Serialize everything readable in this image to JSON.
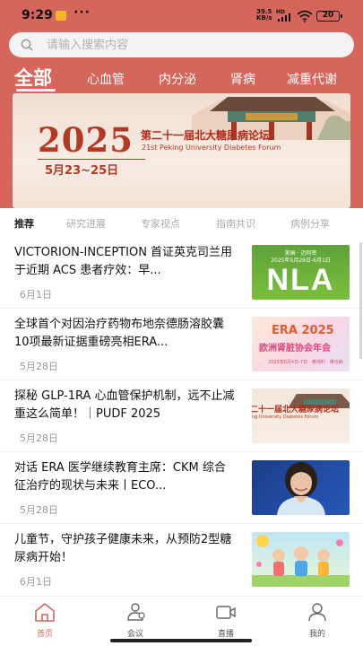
{
  "status_bar": {
    "time": "9:29",
    "dots": "···",
    "net_speed_value": "39.5",
    "net_speed_unit": "KB/s",
    "hd": "HD",
    "battery": "20"
  },
  "search": {
    "placeholder": "请输入搜索内容",
    "value": ""
  },
  "categories": [
    {
      "label": "全部",
      "active": true
    },
    {
      "label": "心血管",
      "active": false
    },
    {
      "label": "内分泌",
      "active": false
    },
    {
      "label": "肾病",
      "active": false
    },
    {
      "label": "减重代谢",
      "active": false
    }
  ],
  "banner": {
    "year": "2025",
    "title": "第二十一届北大糖尿病论坛",
    "subtitle": "21st Peking University Diabetes Forum",
    "date": "5月23~25日"
  },
  "sub_tabs": [
    {
      "label": "推荐",
      "active": true
    },
    {
      "label": "研究进展",
      "active": false
    },
    {
      "label": "专家视点",
      "active": false
    },
    {
      "label": "指南共识",
      "active": false
    },
    {
      "label": "病例分享",
      "active": false
    }
  ],
  "articles": [
    {
      "title": "VICTORION-INCEPTION 首证英克司兰用于近期 ACS 患者疗效：早...",
      "date": "6月1日",
      "thumb": {
        "kind": "nla",
        "top_text": "美国 · 迈阿密",
        "top_text_2": "2025年5月29日-6月1日",
        "logo": "NLA"
      }
    },
    {
      "title": "全球首个对因治疗药物布地奈德肠溶胶囊10项最新证据重磅亮相ERA...",
      "date": "5月28日",
      "thumb": {
        "kind": "era",
        "line1": "ERA 2025",
        "line2": "欧洲肾脏协会年会",
        "line3": "2025年6月4日-7日 · 奥地利 · 维也纳"
      }
    },
    {
      "title": "探秘 GLP-1RA 心血管保护机制，远不止减重这么简单！｜PUDF 2025",
      "date": "5月28日",
      "thumb": {
        "kind": "forum",
        "line1": "二十一届北大糖尿病论坛",
        "line2": "ng University Diabetes Forum"
      }
    },
    {
      "title": "对话 ERA 医学继续教育主席：CKM 综合征治疗的现状与未来丨ECO...",
      "date": "5月28日",
      "thumb": {
        "kind": "portrait"
      }
    },
    {
      "title": "儿童节，守护孩子健康未来，从预防2型糖尿病开始！",
      "date": "6月1日",
      "thumb": {
        "kind": "kids"
      }
    }
  ],
  "bottom_nav": [
    {
      "label": "首页",
      "icon": "home-icon",
      "active": true
    },
    {
      "label": "会议",
      "icon": "meeting-icon",
      "active": false
    },
    {
      "label": "直播",
      "icon": "live-icon",
      "active": false
    },
    {
      "label": "我的",
      "icon": "profile-icon",
      "active": false
    }
  ],
  "colors": {
    "accent": "#d6665c",
    "banner_red": "#b23a25"
  }
}
